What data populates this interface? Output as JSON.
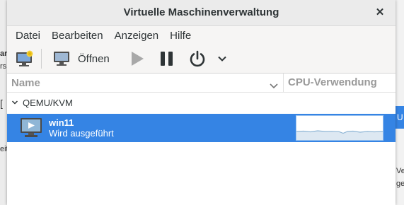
{
  "window": {
    "title": "Virtuelle Maschinenverwaltung"
  },
  "menu": [
    "Datei",
    "Bearbeiten",
    "Anzeigen",
    "Hilfe"
  ],
  "toolbar": {
    "new_icon": "new-vm-icon",
    "open_label": "Öffnen",
    "run_icon": "play-icon",
    "pause_icon": "pause-icon",
    "power_icon": "power-icon",
    "more_icon": "chevron-down-icon"
  },
  "columns": {
    "name": "Name",
    "cpu": "CPU-Verwendung"
  },
  "group": {
    "label": "QEMU/KVM"
  },
  "vm": {
    "name": "win11",
    "status": "Wird ausgeführt"
  },
  "colors": {
    "selection": "#3584e4",
    "graph_line": "#8fb6d6"
  },
  "background": {
    "left_fragments": [
      "ar",
      "rs",
      "[",
      "eit"
    ],
    "right_fragments": [
      "U",
      "Ve",
      "ge"
    ]
  }
}
